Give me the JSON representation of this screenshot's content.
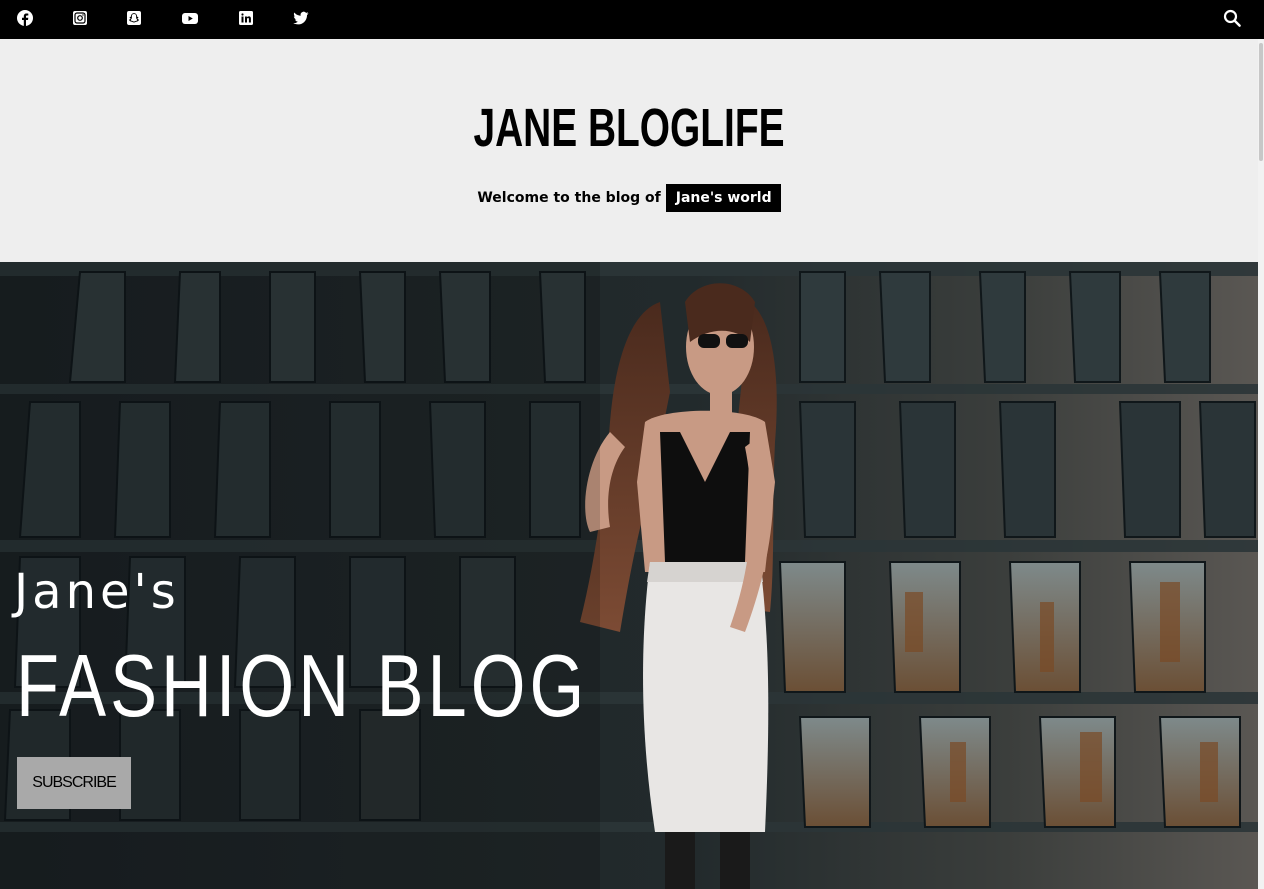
{
  "social": {
    "icons": [
      "facebook-icon",
      "instagram-icon",
      "snapchat-icon",
      "youtube-icon",
      "linkedin-icon",
      "twitter-icon"
    ],
    "search_icon": "search-icon"
  },
  "header": {
    "title": "JANE BLOGLIFE",
    "tagline": "Welcome to the blog of",
    "badge": "Jane's world"
  },
  "hero": {
    "subtitle": "Jane's",
    "title": "FASHION BLOG",
    "button": "SUBSCRIBE"
  },
  "colors": {
    "topbar": "#000000",
    "header_bg": "#eeeeee",
    "badge_bg": "#000000",
    "button_bg": "#a9a9a9"
  }
}
